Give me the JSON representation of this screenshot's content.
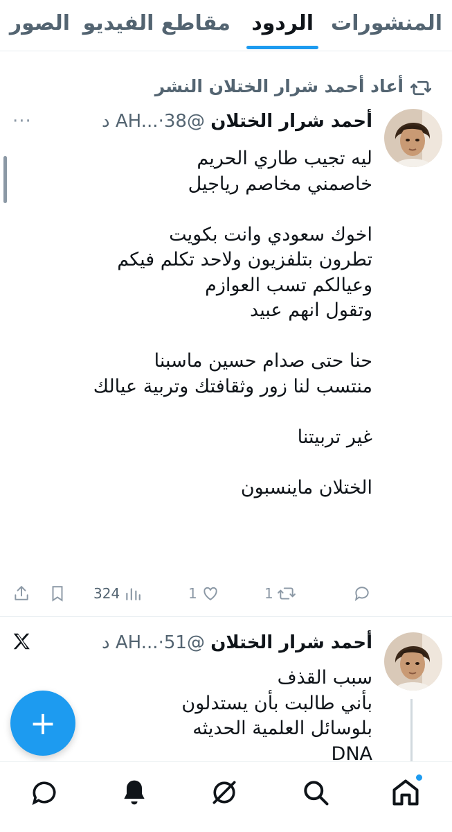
{
  "tabs": [
    {
      "label": "المنشورات",
      "active": false
    },
    {
      "label": "الردود",
      "active": true
    },
    {
      "label": "مقاطع الفيديو",
      "active": false
    },
    {
      "label": "الصور",
      "active": false
    }
  ],
  "repost": {
    "text": "أعاد أحمد شرار الختلان النشر",
    "icon": "repost-icon"
  },
  "tweet1": {
    "name": "أحمد شرار الختلان",
    "handle": "@AH...",
    "dot": "·",
    "time": "38 د",
    "lines": [
      "ليه تجيب طاري الحريم",
      " خاصمني مخاصم رياجيل",
      "",
      "اخوك سعودي وانت بكويت",
      "تطرون بتلفزيون ولاحد تكلم فيكم",
      "وعيالكم تسب العوازم",
      "وتقول انهم عبيد",
      "",
      "حنا حتى صدام حسين ماسبنا",
      "منتسب لنا زور وثقافتك وتربية عيالك",
      "",
      "غير تربيتنا",
      "",
      "الختلان ماينسبون"
    ],
    "actions": {
      "reply_count": "",
      "repost_count": "1",
      "like_count": "1",
      "views_count": "324"
    }
  },
  "tweet2": {
    "name": "أحمد شرار الختلان",
    "handle": "@AH...",
    "dot": "·",
    "time": "51 د",
    "lines": [
      "سبب القذف",
      "بأني طالبت بأن يستدلون",
      "بلوسائل العلمية الحديثه",
      "DNA"
    ]
  },
  "fab": {
    "label": "+"
  },
  "nav": [
    "home-icon",
    "search-icon",
    "grok-icon",
    "notifications-icon",
    "messages-icon"
  ],
  "colors": {
    "accent": "#1d9bf0",
    "muted": "#536471",
    "text": "#0f1419"
  }
}
